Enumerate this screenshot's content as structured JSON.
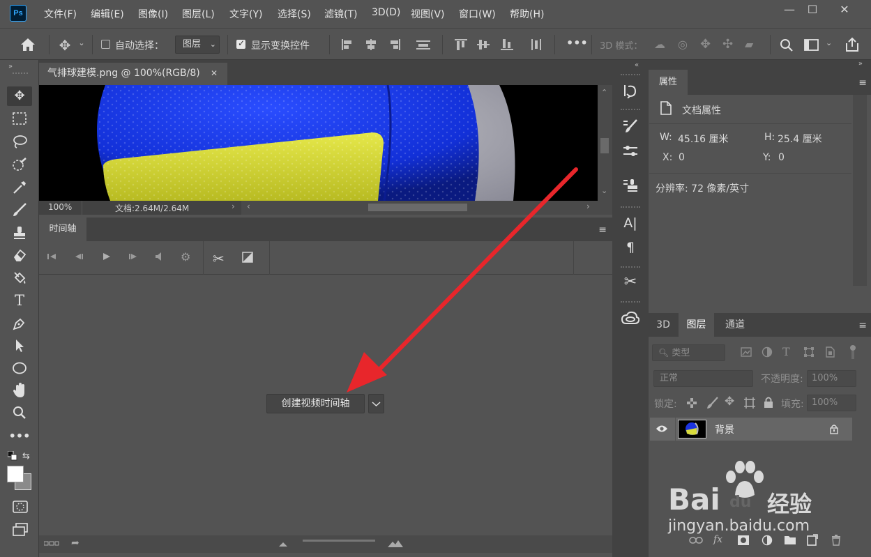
{
  "app": {
    "logo_text": "Ps",
    "menu": [
      "文件(F)",
      "编辑(E)",
      "图像(I)",
      "图层(L)",
      "文字(Y)",
      "选择(S)",
      "滤镜(T)",
      "3D(D)",
      "视图(V)",
      "窗口(W)",
      "帮助(H)"
    ],
    "window_controls": {
      "minimize": "—",
      "maximize": "☐",
      "close": "✕"
    }
  },
  "options_bar": {
    "auto_select_label": "自动选择：",
    "auto_select_value": "图层",
    "auto_select_checked": false,
    "show_transform_label": "显示变换控件",
    "show_transform_checked": true,
    "more": "•••",
    "mode_3d_label": "3D 模式："
  },
  "document": {
    "tab_title": "气排球建模.png @ 100%(RGB/8)",
    "tab_close": "✕",
    "zoom": "100%",
    "doc_size": "文档:2.64M/2.64M"
  },
  "timeline": {
    "tab_label": "时间轴",
    "create_button": "创建视频时间轴"
  },
  "properties": {
    "tab_label": "属性",
    "section_label": "文档属性",
    "w_label": "W:",
    "w_value": "45.16 厘米",
    "h_label": "H:",
    "h_value": "25.4 厘米",
    "x_label": "X:",
    "x_value": "0",
    "y_label": "Y:",
    "y_value": "0",
    "resolution": "分辨率: 72 像素/英寸"
  },
  "layers_panel": {
    "tabs": [
      "3D",
      "图层",
      "通道"
    ],
    "active_tab": "图层",
    "filter_type": "类型",
    "blend_mode": "正常",
    "opacity_label": "不透明度:",
    "opacity_value": "100%",
    "lock_label": "锁定:",
    "fill_label": "填充:",
    "fill_value": "100%",
    "layer_name": "背景",
    "footer_fx": "fx"
  },
  "watermark": {
    "brand": "Bai",
    "brand_tail": "du",
    "cn": "经验",
    "url": "jingyan.baidu.com"
  },
  "colors": {
    "panel": "#535353",
    "dark": "#424242",
    "arrow": "#e8262b",
    "ps_blue": "#31a8ff"
  }
}
